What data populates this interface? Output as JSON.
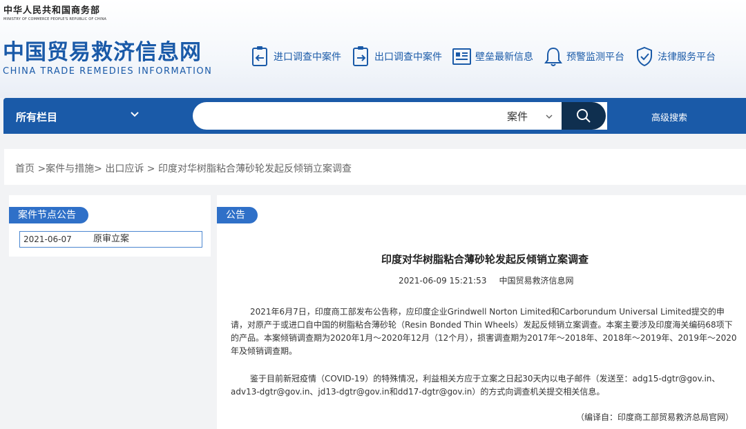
{
  "header": {
    "ministry_cn": "中华人民共和国商务部",
    "ministry_en": "MINISTRY OF COMMERCE PEOPLE'S REPUBLIC OF CHINA",
    "site_title_cn": "中国贸易救济信息网",
    "site_title_en": "CHINA TRADE REMEDIES INFORMATION",
    "nav": [
      {
        "label": "进口调查中案件",
        "icon": "import-case-icon"
      },
      {
        "label": "出口调查中案件",
        "icon": "export-case-icon"
      },
      {
        "label": "壁垒最新信息",
        "icon": "barrier-news-icon"
      },
      {
        "label": "预警监测平台",
        "icon": "bell-icon"
      },
      {
        "label": "法律服务平台",
        "icon": "shield-check-icon"
      }
    ]
  },
  "search": {
    "all_columns": "所有栏目",
    "placeholder": "",
    "scope": "案件",
    "advanced": "高级搜索"
  },
  "breadcrumb": "首页 >案件与措施> 出口应诉 > 印度对华树脂粘合薄砂轮发起反倾销立案调查",
  "left_panel": {
    "tab": "案件节点公告",
    "items": [
      {
        "date": "2021-06-07",
        "label": "原审立案"
      }
    ]
  },
  "main": {
    "tab": "公告",
    "title": "印度对华树脂粘合薄砂轮发起反倾销立案调查",
    "datetime": "2021-06-09 15:21:53",
    "source": "中国贸易救济信息网",
    "para1": "2021年6月7日，印度商工部发布公告称，应印度企业Grindwell Norton Limited和Carborundum Universal Limited提交的申请，对原产于或进口自中国的树脂粘合薄砂轮（Resin Bonded Thin Wheels）发起反倾销立案调查。本案主要涉及印度海关编码68项下的产品。本案倾销调查期为2020年1月～2020年12月（12个月），损害调查期为2017年～2018年、2018年～2019年、2019年～2020年及倾销调查期。",
    "para2": "鉴于目前新冠疫情（COVID-19）的特殊情况，利益相关方应于立案之日起30天内以电子邮件（发送至：adg15-dgtr@gov.in、adv13-dgtr@gov.in、jd13-dgtr@gov.in和dd17-dgtr@gov.in）的方式向调查机关提交相关信息。",
    "credit": "（编译自：印度商工部贸易救济总局官网）"
  },
  "colors": {
    "brand_blue": "#1a5aa8",
    "tab_blue": "#2f70c8",
    "search_btn": "#0f2f4f"
  }
}
